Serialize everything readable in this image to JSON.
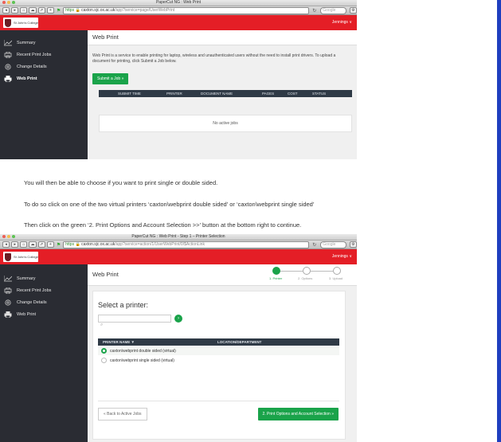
{
  "screen1": {
    "window_title": "PaperCut NG : Web Print",
    "url": {
      "scheme": "https",
      "host": "caxton.sjc.ox.ac.uk",
      "path": "/app?service=page/UserWebPrint"
    },
    "search_placeholder": "Google",
    "header": {
      "logo_text": "St John's College",
      "user_menu": "Jennings ∨"
    },
    "sidebar": [
      {
        "icon": "chart-icon",
        "label": "Summary"
      },
      {
        "icon": "printer-list-icon",
        "label": "Recent Print Jobs"
      },
      {
        "icon": "gear-icon",
        "label": "Change Details"
      },
      {
        "icon": "printer-icon",
        "label": "Web Print"
      }
    ],
    "page_title": "Web Print",
    "description": "Web Print is a service to enable printing for laptop, wireless and unauthenticated users without the need to install print drivers. To upload a document for printing, click Submit a Job below.",
    "submit_button": "Submit a Job »",
    "table_headers": [
      "SUBMIT TIME",
      "PRINTER",
      "DOCUMENT NAME",
      "PAGES",
      "COST",
      "STATUS"
    ],
    "empty_message": "No active jobs"
  },
  "instructions": {
    "line1": "You will then be able to choose if you want to print single or double sided.",
    "line2": "To do so click on one of the two virtual printers ‘caxton\\webprint double sided’ or ‘caxton\\webprint single sided’",
    "line3": "Then click on the green ‘2. Print Options and Account Selection >>’ button at the bottom right to continue."
  },
  "screen2": {
    "window_title": "PaperCut NG : Web Print - Step 1 – Printer Selection",
    "url": {
      "scheme": "https",
      "host": "caxton.sjc.ox.ac.uk",
      "path": "/app?service=action/1/UserWebPrint/0/$ActionLink"
    },
    "search_placeholder": "Google",
    "header": {
      "logo_text": "St John's College",
      "user_menu": "Jennings ∨"
    },
    "sidebar": [
      {
        "icon": "chart-icon",
        "label": "Summary"
      },
      {
        "icon": "printer-list-icon",
        "label": "Recent Print Jobs"
      },
      {
        "icon": "gear-icon",
        "label": "Change Details"
      },
      {
        "icon": "printer-icon",
        "label": "Web Print"
      }
    ],
    "page_title": "Web Print",
    "steps": [
      {
        "label": "1. Printer",
        "active": true
      },
      {
        "label": "2. Options",
        "active": false
      },
      {
        "label": "3. Upload",
        "active": false
      }
    ],
    "select_label": "Select a printer:",
    "search_icon": "search-icon",
    "table_headers": [
      "PRINTER NAME ▼",
      "LOCATION/DEPARTMENT"
    ],
    "printers": [
      {
        "name": "caxton\\webprint double sided (virtual)",
        "selected": true
      },
      {
        "name": "caxton\\webprint single sided (virtual)",
        "selected": false
      }
    ],
    "back_button": "« Back to Active Jobs",
    "next_button": "2. Print Options and Account Selection »"
  },
  "colors": {
    "brand_red": "#e41e26",
    "sidebar_bg": "#2a2c33",
    "green": "#1aa34a",
    "table_head": "#2f3a46",
    "slide_blue": "#1f3fbf"
  }
}
